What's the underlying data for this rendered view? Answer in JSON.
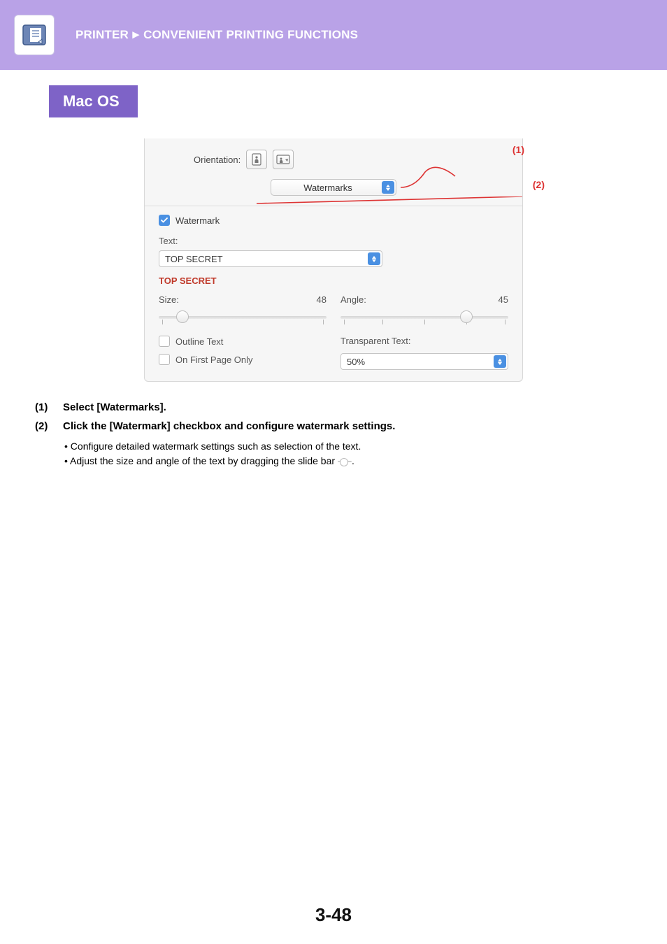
{
  "header": {
    "section": "PRINTER",
    "subsection": "CONVENIENT PRINTING FUNCTIONS"
  },
  "os_badge": "Mac OS",
  "dialog": {
    "orientation_label": "Orientation:",
    "popup_selected": "Watermarks",
    "watermark_checkbox_label": "Watermark",
    "text_label": "Text:",
    "text_value": "TOP SECRET",
    "preview_text": "TOP SECRET",
    "size_label": "Size:",
    "size_value": "48",
    "angle_label": "Angle:",
    "angle_value": "45",
    "outline_text_label": "Outline Text",
    "first_page_only_label": "On First Page Only",
    "transparent_text_label": "Transparent Text:",
    "transparent_value": "50%"
  },
  "callouts": {
    "one": "(1)",
    "two": "(2)"
  },
  "steps": {
    "s1_num": "(1)",
    "s1_title": "Select [Watermarks].",
    "s2_num": "(2)",
    "s2_title": "Click the [Watermark] checkbox and configure watermark settings.",
    "s2_b1": "• Configure detailed watermark settings such as selection of the text.",
    "s2_b2_a": "• Adjust the size and angle of the text by dragging the slide bar ",
    "s2_b2_b": "."
  },
  "page_number": "3-48"
}
